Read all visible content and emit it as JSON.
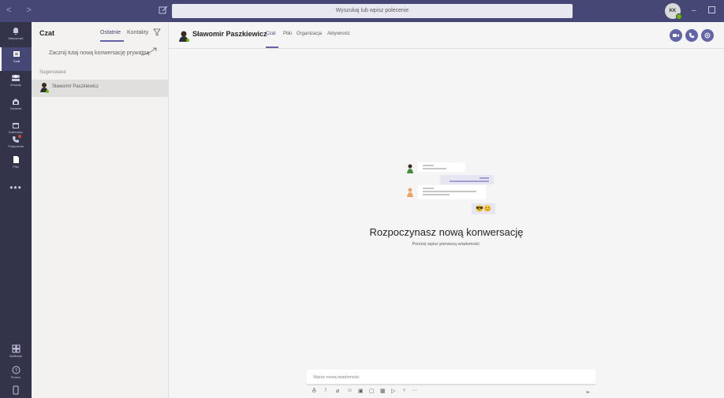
{
  "titlebar": {
    "nav": "< >",
    "search_placeholder": "Wyszukaj lub wpisz polecenie",
    "avatar_initials": "KK",
    "minimize": "–"
  },
  "rail": {
    "items": [
      {
        "label": "Aktywność",
        "icon": "bell-icon"
      },
      {
        "label": "Czat",
        "icon": "chat-icon",
        "active": true
      },
      {
        "label": "Zespoły",
        "icon": "teams-icon"
      },
      {
        "label": "Zadania",
        "icon": "assignments-icon"
      },
      {
        "label": "Kalendarz",
        "icon": "calendar-icon"
      },
      {
        "label": "Połączenia",
        "icon": "phone-icon"
      },
      {
        "label": "Pliki",
        "icon": "files-icon"
      }
    ],
    "more": "•••",
    "bottom": [
      {
        "label": "Aplikacje",
        "icon": "apps-icon"
      },
      {
        "label": "Pomoc",
        "icon": "help-icon"
      }
    ]
  },
  "chatlist": {
    "title": "Czat",
    "tab_recent": "Ostatnie",
    "tab_contacts": "Kontakty",
    "start_hint": "Zacznij tutaj nową konwersację prywatną.",
    "section_label": "Sugerowane",
    "items": [
      {
        "name": "Sławomir Paszkiewicz"
      }
    ]
  },
  "main": {
    "contact_name": "Sławomir Paszkiewicz",
    "tabs": [
      "Czat",
      "Pliki",
      "Organizacja",
      "Aktywność"
    ],
    "empty_title": "Rozpoczynasz nową konwersację",
    "empty_subtitle": "Poniżej wpisz pierwszą wiadomość.",
    "composer_placeholder": "Wpisz nową wiadomość",
    "emoji": "😎😊"
  },
  "colors": {
    "accent": "#6264a7",
    "titlebar": "#464775",
    "rail": "#33344a"
  }
}
